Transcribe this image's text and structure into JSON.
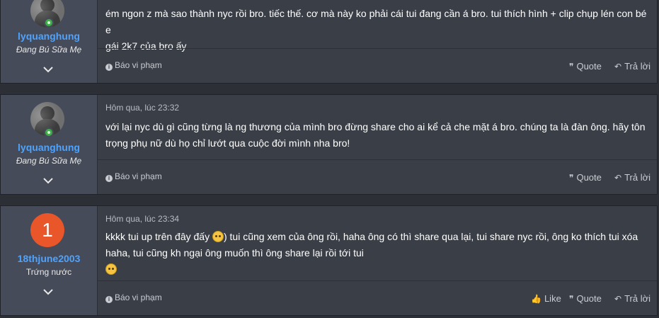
{
  "posts": [
    {
      "username": "lyquanghung",
      "user_title": "Đang Bú Sữa Mẹ",
      "date": "",
      "body_line1": "ém ngon z mà sao thành nyc rồi bro. tiếc thế. cơ mà này ko phải cái tui đang cần á bro. tui thích hình + clip chụp lén con bé e",
      "body_line2": "gái 2k7 của bro ấy",
      "report": "Báo vi phạm",
      "quote": "Quote",
      "reply": "Trả lời"
    },
    {
      "username": "lyquanghung",
      "user_title": "Đang Bú Sữa Mẹ",
      "date": "Hôm qua, lúc 23:32",
      "body_line1": "với lại nyc dù gì cũng từng là ng thương của mình bro đừng share cho ai kể cả che mặt á bro. chúng ta là đàn ông. hãy tôn",
      "body_line2": "trọng phụ nữ dù họ chỉ lướt qua cuộc đời mình nha bro!",
      "report": "Báo vi phạm",
      "quote": "Quote",
      "reply": "Trả lời"
    },
    {
      "username": "18thjune2003",
      "user_title": "Trứng nước",
      "avatar_letter": "1",
      "avatar_color": "#e8562a",
      "date": "Hôm qua, lúc 23:34",
      "body_line1a": "kkkk tui up trên đây đấy",
      "body_line1b": ") tui cũng xem của ông rồi, haha ông có thì share qua lại, tui share nyc rồi, ông ko thích tui xóa",
      "body_line2": "haha, tui cũng kh ngại ông muốn thì ông share lại rồi tới tui",
      "report": "Báo vi phạm",
      "like": "Like",
      "quote": "Quote",
      "reply": "Trả lời"
    }
  ],
  "colors": {
    "username": "#4ea3ff",
    "online": "#3fae49",
    "user_panel": "#454b59",
    "post_bg": "#3a3e47"
  },
  "icons": [
    "chevron-down-icon",
    "info-icon",
    "quote-icon",
    "reply-icon",
    "like-icon",
    "emoji-icon",
    "online-status-icon"
  ]
}
